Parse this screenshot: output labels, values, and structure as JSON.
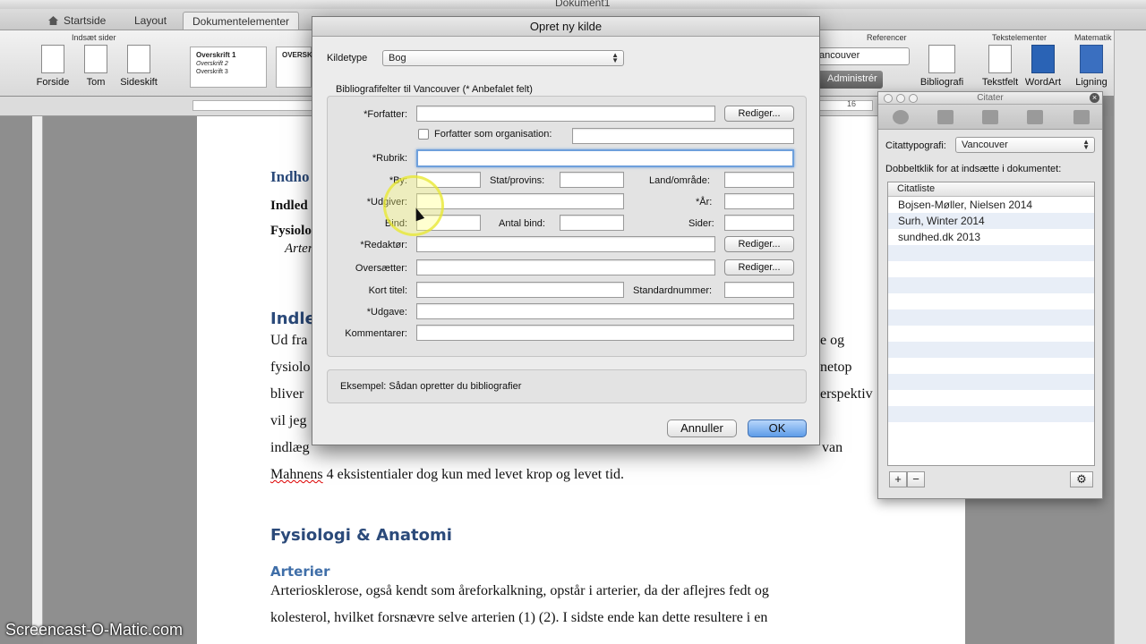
{
  "window": {
    "title": "Dokument1"
  },
  "tabs": [
    {
      "label": "Startside"
    },
    {
      "label": "Layout"
    },
    {
      "label": "Dokumentelementer"
    }
  ],
  "ribbon": {
    "insert_pages_group": "Indsæt sider",
    "buttons": {
      "cover": "Forside",
      "blank": "Tom",
      "page_break": "Sideskift"
    },
    "styles": [
      {
        "line1": "Overskrift 1",
        "line2": "Overskrift 2",
        "line3": "Overskrift 3",
        "nums": "1 2 3"
      },
      {
        "line1": "OVERSK"
      }
    ],
    "references_group": "Referencer",
    "citation_style": "ancouver",
    "manage_label": "Administrér",
    "text_elements_group": "Tekstelementer",
    "math_group": "Matematik",
    "bibliography": "Bibliografi",
    "textbox": "Tekstfelt",
    "wordart": "WordArt",
    "equation": "Ligning"
  },
  "ruler": {
    "mark16": "16"
  },
  "document": {
    "toc_heading": "Indho",
    "toc_line1": "Indled",
    "toc_line2": "Fysiolo",
    "toc_line3": "Arter",
    "heading1": "Indle",
    "para_line1_a": "Ud fra",
    "para_line1_b": "e og",
    "para_line2_a": "fysiolo",
    "para_line2_b": "netop",
    "para_line3_a": "bliver",
    "para_line3_b": "erspektiv",
    "para_line4": "vil jeg",
    "para_line5_a": "indlæg",
    "para_line5_b": "van",
    "para_line6_a": "Mahnens",
    "para_line6_b": " 4 eksistentialer dog kun med levet krop og levet tid.",
    "heading2": "Fysiologi & Anatomi",
    "heading3": "Arterier",
    "para2_line1": "Arteriosklerose, også kendt som åreforkalkning, opstår i arterier, da der aflejres fedt og",
    "para2_line2": "kolesterol, hvilket forsnævre selve arterien (1) (2). I sidste ende kan dette resultere i en"
  },
  "dialog": {
    "title": "Opret ny kilde",
    "source_type_label": "Kildetype",
    "source_type_value": "Bog",
    "fields_heading": "Bibliografifelter til Vancouver  (* Anbefalet felt)",
    "author": "*Forfatter:",
    "edit": "Rediger...",
    "author_org": "Forfatter som organisation:",
    "title_field": "*Rubrik:",
    "city": "*By:",
    "state": "Stat/provins:",
    "country": "Land/område:",
    "publisher": "*Udgiver:",
    "year": "*År:",
    "volume": "Bind:",
    "num_volumes": "Antal bind:",
    "pages": "Sider:",
    "editor": "*Redaktør:",
    "translator": "Oversætter:",
    "short_title": "Kort titel:",
    "standard_number": "Standardnummer:",
    "edition": "*Udgave:",
    "comments": "Kommentarer:",
    "example": "Eksempel: Sådan opretter du bibliografier",
    "cancel": "Annuller",
    "ok": "OK"
  },
  "citations_palette": {
    "title": "Citater",
    "style_label": "Citattypografi:",
    "style_value": "Vancouver",
    "instruction": "Dobbeltklik for at indsætte i dokumentet:",
    "list_header": "Citatliste",
    "items": [
      "Bojsen-Møller,  Nielsen 2014",
      "Surh,  Winter 2014",
      "sundhed.dk 2013"
    ],
    "add": "+",
    "remove": "−"
  },
  "watermark": "Screencast-O-Matic.com"
}
